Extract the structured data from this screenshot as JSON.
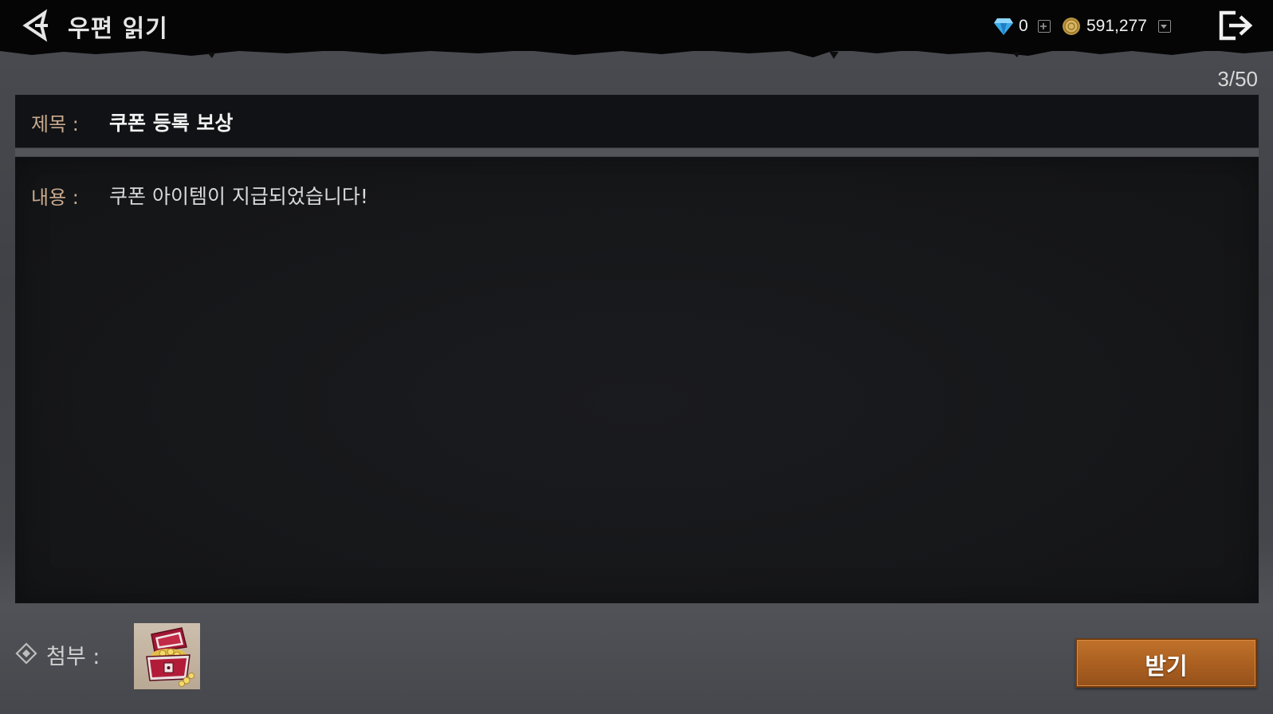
{
  "header": {
    "title": "우편 읽기",
    "back_icon": "back-arrow-icon",
    "exit_icon": "exit-icon"
  },
  "currency": {
    "gems": {
      "icon": "gem-icon",
      "value": "0"
    },
    "gold": {
      "icon": "gold-coin-icon",
      "value": "591,277"
    }
  },
  "mail": {
    "counter": "3/50",
    "subject_label": "제목 :",
    "subject": "쿠폰 등록 보상",
    "content_label": "내용 :",
    "content": "쿠폰 아이템이 지급되었습니다!",
    "attachment_label": "첨부 :",
    "attachment_icon": "treasure-chest-icon"
  },
  "actions": {
    "receive_label": "받기"
  },
  "colors": {
    "label_accent": "#c9ab8f",
    "button_orange": "#b0621f"
  }
}
